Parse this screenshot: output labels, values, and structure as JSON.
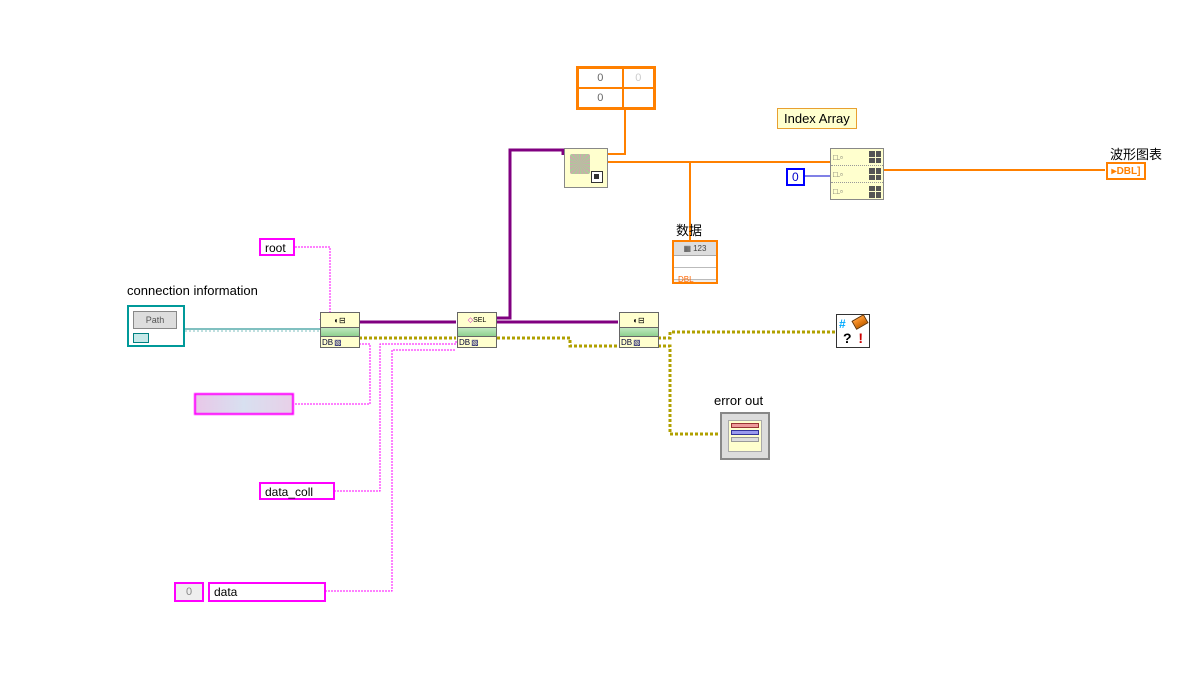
{
  "labels": {
    "connection_info": "connection information",
    "root": "root",
    "data_coll": "data_coll",
    "data": "data",
    "index_array": "Index Array",
    "waveform_chart": "波形图表",
    "data_zh": "数据",
    "error_out": "error out"
  },
  "constants": {
    "build_array_00": "0",
    "build_array_10": "0",
    "build_array_01_dim": "0",
    "index_zero": "0",
    "data_idx": "0"
  },
  "node_text": {
    "db_label": "DB",
    "path_label": "Path",
    "sel_label": "SEL",
    "variant_top": "123",
    "variant_dbl": "DBL",
    "dbl_indicator": "▸DBL]"
  }
}
